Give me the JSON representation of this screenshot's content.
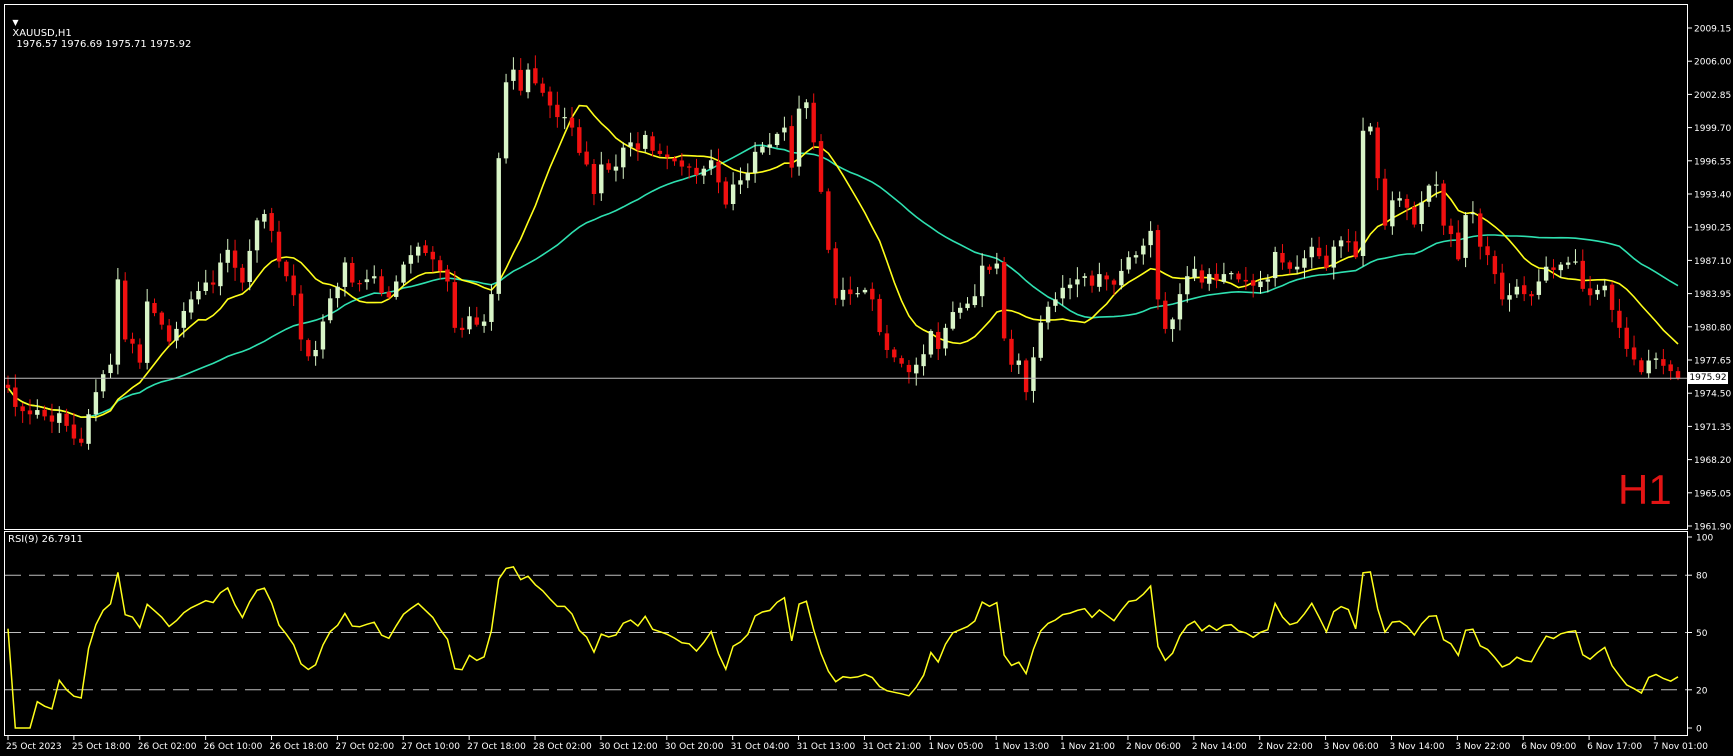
{
  "header": {
    "symbol": "XAUUSD,H1",
    "ohlc": "1976.57 1976.69 1975.71 1975.92",
    "timeframe_badge": "H1",
    "rsi_label": "RSI(9) 26.7911"
  },
  "current_price_label": "1975.92",
  "colors": {
    "background": "#000000",
    "frame": "#ffffff",
    "bull_candle": "#d9f5c8",
    "bear_candle": "#f01010",
    "ma_fast": "#ffff1a",
    "ma_slow": "#2ee0b0",
    "rsi_line": "#ffff1a",
    "timeframe_badge": "#e11414"
  },
  "chart_data": [
    {
      "type": "candlestick",
      "symbol": "XAUUSD",
      "timeframe": "H1",
      "ylim": [
        1961.9,
        2010.5
      ],
      "y_ticks": [
        "2009.15",
        "2006.00",
        "2002.85",
        "1999.70",
        "1996.55",
        "1993.40",
        "1990.25",
        "1987.10",
        "1983.95",
        "1980.80",
        "1977.65",
        "1974.50",
        "1971.35",
        "1968.20",
        "1965.05",
        "1961.90"
      ],
      "x_ticks": [
        "25 Oct 2023",
        "25 Oct 18:00",
        "26 Oct 02:00",
        "26 Oct 10:00",
        "26 Oct 18:00",
        "27 Oct 02:00",
        "27 Oct 10:00",
        "27 Oct 18:00",
        "28 Oct 02:00",
        "30 Oct 12:00",
        "30 Oct 20:00",
        "31 Oct 04:00",
        "31 Oct 13:00",
        "31 Oct 21:00",
        "1 Nov 05:00",
        "1 Nov 13:00",
        "1 Nov 21:00",
        "2 Nov 06:00",
        "2 Nov 14:00",
        "2 Nov 22:00",
        "3 Nov 06:00",
        "3 Nov 14:00",
        "3 Nov 22:00",
        "6 Nov 09:00",
        "6 Nov 17:00",
        "7 Nov 01:00"
      ],
      "current_price": 1975.92,
      "close_path": [
        1975.0,
        1973.2,
        1972.8,
        1972.5,
        1972.9,
        1972.3,
        1971.8,
        1972.6,
        1971.4,
        1970.2,
        1969.8,
        1972.5,
        1974.6,
        1976.3,
        1977.2,
        1985.3,
        1979.6,
        1979.2,
        1977.4,
        1983.2,
        1982.1,
        1981.0,
        1979.4,
        1980.6,
        1982.3,
        1983.4,
        1984.2,
        1985.0,
        1984.8,
        1986.9,
        1988.1,
        1986.4,
        1985.0,
        1988.0,
        1990.9,
        1991.5,
        1989.9,
        1987.0,
        1985.6,
        1983.8,
        1979.6,
        1978.0,
        1978.6,
        1981.3,
        1983.5,
        1984.6,
        1986.9,
        1985.0,
        1984.9,
        1985.3,
        1985.6,
        1984.0,
        1983.6,
        1985.1,
        1986.7,
        1987.6,
        1988.4,
        1987.8,
        1987.2,
        1986.1,
        1985.1,
        1980.7,
        1980.5,
        1981.8,
        1981.0,
        1981.3,
        1983.9,
        1996.8,
        2004.0,
        2005.2,
        2003.2,
        2005.2,
        2003.9,
        2003.0,
        2001.8,
        2000.7,
        2000.7,
        1999.7,
        1997.3,
        1996.2,
        1993.4,
        1996.2,
        1995.7,
        1996.0,
        1997.8,
        1998.3,
        1997.6,
        1999.0,
        1997.5,
        1997.2,
        1996.9,
        1996.5,
        1996.0,
        1995.9,
        1995.2,
        1995.8,
        1996.6,
        1994.5,
        1992.4,
        1994.3,
        1994.7,
        1995.4,
        1997.4,
        1997.9,
        1998.1,
        1999.1,
        1999.7,
        1995.9,
        2001.5,
        2002.1,
        1998.3,
        1993.6,
        1988.1,
        1983.5,
        1984.3,
        1983.9,
        1984.0,
        1984.3,
        1983.4,
        1980.3,
        1978.6,
        1977.9,
        1977.3,
        1976.5,
        1977.2,
        1978.2,
        1980.4,
        1978.7,
        1980.7,
        1982.2,
        1982.6,
        1983.0,
        1983.7,
        1986.6,
        1986.2,
        1986.8,
        1979.7,
        1977.2,
        1977.6,
        1974.6,
        1977.9,
        1981.2,
        1982.7,
        1983.4,
        1984.5,
        1984.8,
        1985.3,
        1985.6,
        1984.7,
        1985.8,
        1985.3,
        1984.8,
        1986.1,
        1987.4,
        1987.6,
        1988.5,
        1989.9,
        1983.4,
        1980.6,
        1981.5,
        1983.9,
        1985.6,
        1986.3,
        1985.0,
        1985.8,
        1985.2,
        1985.8,
        1985.9,
        1985.3,
        1985.1,
        1984.7,
        1985.1,
        1985.3,
        1987.9,
        1986.9,
        1986.3,
        1986.5,
        1987.3,
        1988.4,
        1987.5,
        1986.4,
        1988.4,
        1989.0,
        1988.8,
        1987.4,
        1999.4,
        1999.8,
        1994.9,
        1990.4,
        1992.8,
        1993.0,
        1992.1,
        1990.5,
        1992.6,
        1994.2,
        1994.3,
        1990.4,
        1989.6,
        1987.2,
        1991.4,
        1991.6,
        1988.4,
        1987.6,
        1985.8,
        1983.4,
        1983.8,
        1984.6,
        1983.9,
        1983.7,
        1985.1,
        1986.5,
        1986.2,
        1986.7,
        1986.9,
        1987.0,
        1984.4,
        1983.8,
        1984.3,
        1984.7,
        1982.4,
        1980.7,
        1978.7,
        1977.7,
        1976.5,
        1977.6,
        1977.8,
        1977.1,
        1976.6,
        1975.92
      ]
    },
    {
      "type": "line",
      "name": "RSI(9)",
      "value": 26.7911,
      "ylim": [
        0,
        100
      ],
      "y_ticks": [
        100,
        80,
        50,
        20,
        0
      ],
      "levels": [
        80,
        50,
        20
      ]
    }
  ]
}
